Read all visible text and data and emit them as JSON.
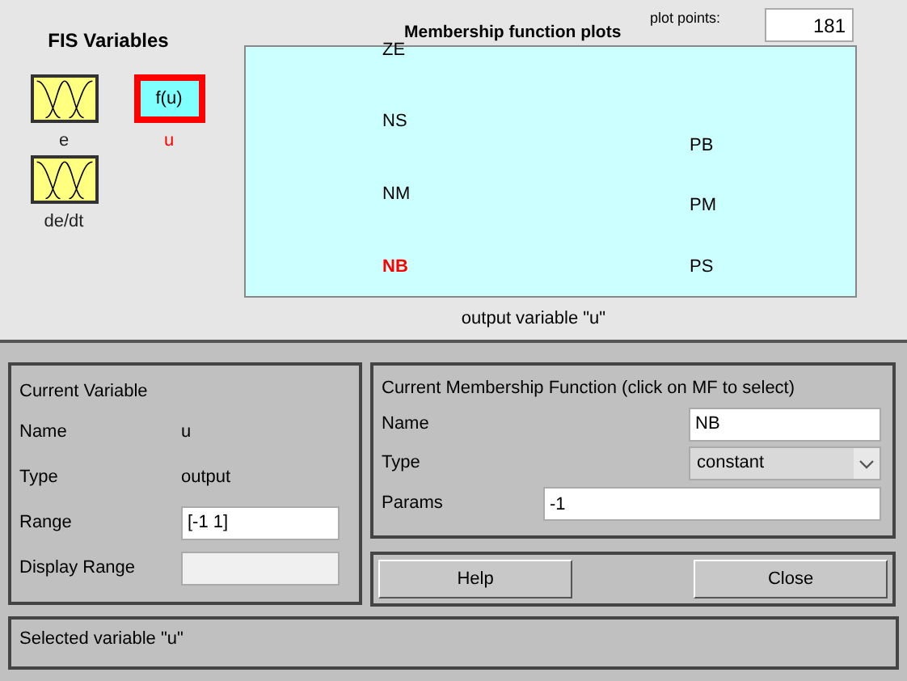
{
  "fis_variables": {
    "title": "FIS Variables",
    "items": [
      {
        "label": "e",
        "kind": "input",
        "selected": false
      },
      {
        "label": "de/dt",
        "kind": "input",
        "selected": false
      },
      {
        "label": "u",
        "kind": "output",
        "icon_text": "f(u)",
        "selected": true
      }
    ]
  },
  "plot": {
    "title": "Membership function plots",
    "plot_points_label": "plot points:",
    "plot_points": "181",
    "xlabel": "output variable \"u\"",
    "mfs": [
      {
        "label": "ZE",
        "selected": false
      },
      {
        "label": "NS",
        "selected": false
      },
      {
        "label": "NM",
        "selected": false
      },
      {
        "label": "NB",
        "selected": true
      },
      {
        "label": "PB",
        "selected": false
      },
      {
        "label": "PM",
        "selected": false
      },
      {
        "label": "PS",
        "selected": false
      }
    ]
  },
  "current_variable": {
    "title": "Current Variable",
    "name_label": "Name",
    "name": "u",
    "type_label": "Type",
    "type": "output",
    "range_label": "Range",
    "range": "[-1 1]",
    "display_range_label": "Display Range"
  },
  "current_mf": {
    "title": "Current Membership Function (click on MF to select)",
    "name_label": "Name",
    "name": "NB",
    "type_label": "Type",
    "type": "constant",
    "params_label": "Params",
    "params": "-1"
  },
  "buttons": [
    "Help",
    "Close"
  ],
  "status": "Selected variable \"u\""
}
